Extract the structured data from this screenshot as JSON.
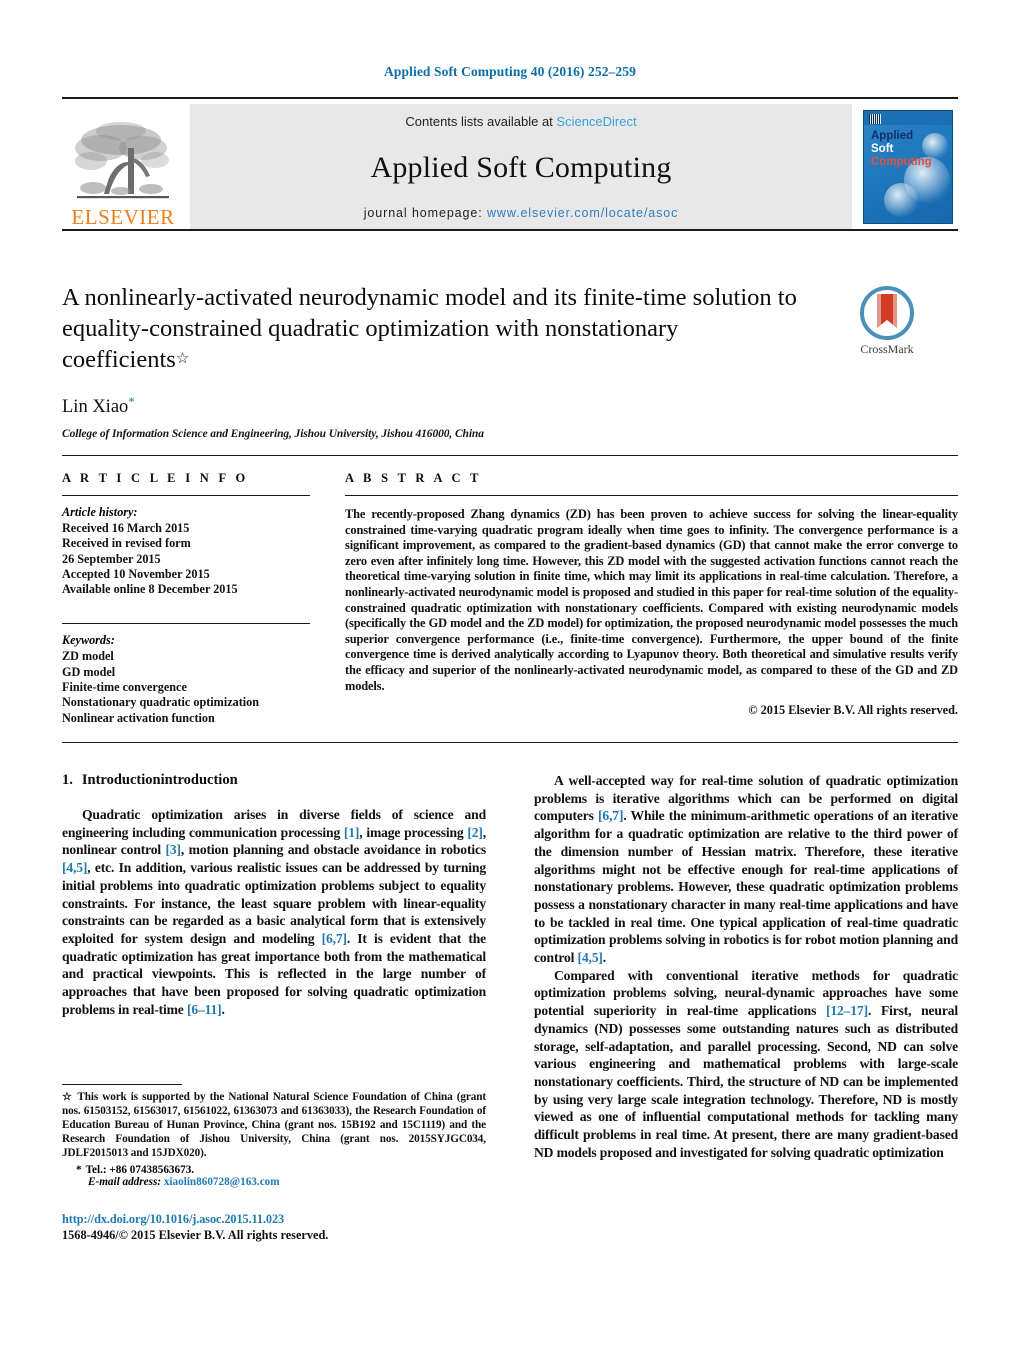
{
  "running_head": "Applied Soft Computing 40 (2016) 252–259",
  "masthead": {
    "publisher_name": "ELSEVIER",
    "contents_prefix": "Contents lists available at ",
    "sciencedirect": "ScienceDirect",
    "journal_title": "Applied Soft Computing",
    "homepage_prefix": "journal homepage: ",
    "homepage_url": "www.elsevier.com/locate/asoc",
    "cover": {
      "line1": "Applied",
      "line2": "Soft",
      "line3": "Computing"
    }
  },
  "article": {
    "title": "A nonlinearly-activated neurodynamic model and its finite-time solution to equality-constrained quadratic optimization with nonstationary coefficients",
    "title_footnote_mark": "☆",
    "author": "Lin Xiao",
    "author_footnote_mark": "*",
    "affiliation": "College of Information Science and Engineering, Jishou University, Jishou 416000, China",
    "crossmark_label": "CrossMark"
  },
  "info": {
    "heading": "A R T I C L E   I N F O",
    "history_label": "Article history:",
    "history_lines": [
      "Received 16 March 2015",
      "Received in revised form",
      "26 September 2015",
      "Accepted 10 November 2015",
      "Available online 8 December 2015"
    ],
    "keywords_label": "Keywords:",
    "keywords": [
      "ZD model",
      "GD model",
      "Finite-time convergence",
      "Nonstationary quadratic optimization",
      "Nonlinear activation function"
    ]
  },
  "abstract": {
    "heading": "A B S T R A C T",
    "text": "The recently-proposed Zhang dynamics (ZD) has been proven to achieve success for solving the linear-equality constrained time-varying quadratic program ideally when time goes to infinity. The convergence performance is a significant improvement, as compared to the gradient-based dynamics (GD) that cannot make the error converge to zero even after infinitely long time. However, this ZD model with the suggested activation functions cannot reach the theoretical time-varying solution in finite time, which may limit its applications in real-time calculation. Therefore, a nonlinearly-activated neurodynamic model is proposed and studied in this paper for real-time solution of the equality-constrained quadratic optimization with nonstationary coefficients. Compared with existing neurodynamic models (specifically the GD model and the ZD model) for optimization, the proposed neurodynamic model possesses the much superior convergence performance (i.e., finite-time convergence). Furthermore, the upper bound of the finite convergence time is derived analytically according to Lyapunov theory. Both theoretical and simulative results verify the efficacy and superior of the nonlinearly-activated neurodynamic model, as compared to these of the GD and ZD models.",
    "copyright": "© 2015 Elsevier B.V. All rights reserved."
  },
  "introduction": {
    "number": "1.",
    "title": "Introductionintroduction",
    "left_paragraphs": [
      "Quadratic optimization arises in diverse fields of science and engineering including communication processing [1], image processing [2], nonlinear control [3], motion planning and obstacle avoidance in robotics [4,5], etc. In addition, various realistic issues can be addressed by turning initial problems into quadratic optimization problems subject to equality constraints. For instance, the least square problem with linear-equality constraints can be regarded as a basic analytical form that is extensively exploited for system design and modeling [6,7]. It is evident that the quadratic optimization has great importance both from the mathematical and practical viewpoints. This is reflected in the large number of approaches that have been proposed for solving quadratic optimization problems in real-time [6–11]."
    ],
    "right_paragraphs": [
      "A well-accepted way for real-time solution of quadratic optimization problems is iterative algorithms which can be performed on digital computers [6,7]. While the minimum-arithmetic operations of an iterative algorithm for a quadratic optimization are relative to the third power of the dimension number of Hessian matrix. Therefore, these iterative algorithms might not be effective enough for real-time applications of nonstationary problems. However, these quadratic optimization problems possess a nonstationary character in many real-time applications and have to be tackled in real time. One typical application of real-time quadratic optimization problems solving in robotics is for robot motion planning and control [4,5].",
      "Compared with conventional iterative methods for quadratic optimization problems solving, neural-dynamic approaches have some potential superiority in real-time applications [12–17]. First, neural dynamics (ND) possesses some outstanding natures such as distributed storage, self-adaptation, and parallel processing. Second, ND can solve various engineering and mathematical problems with large-scale nonstationary coefficients. Third, the structure of ND can be implemented by using very large scale integration technology. Therefore, ND is mostly viewed as one of influential computational methods for tackling many difficult problems in real time. At present, there are many gradient-based ND models proposed and investigated for solving quadratic optimization"
    ]
  },
  "footnotes": {
    "funding_mark": "☆",
    "funding": "This work is supported by the National Natural Science Foundation of China (grant nos. 61503152, 61563017, 61561022, 61363073 and 61363033), the Research Foundation of Education Bureau of Hunan Province, China (grant nos. 15B192 and 15C1119) and the Research Foundation of Jishou University, China (grant nos. 2015SYJGC034, JDLF2015013 and 15JDX020).",
    "tel_mark": "*",
    "tel": "Tel.: +86 07438563673.",
    "email_label": "E-mail address:",
    "email": "xiaolin860728@163.com"
  },
  "footer": {
    "doi": "http://dx.doi.org/10.1016/j.asoc.2015.11.023",
    "issn": "1568-4946/© 2015 Elsevier B.V. All rights reserved."
  },
  "colors": {
    "link_blue": "#1f7ab0",
    "header_blue": "#0b6ea8",
    "sciencedirect_blue": "#3ba3dd",
    "elsevier_orange": "#ef7d1a",
    "cover_blue": "#2078bd",
    "crossmark_red": "#d23c24"
  }
}
